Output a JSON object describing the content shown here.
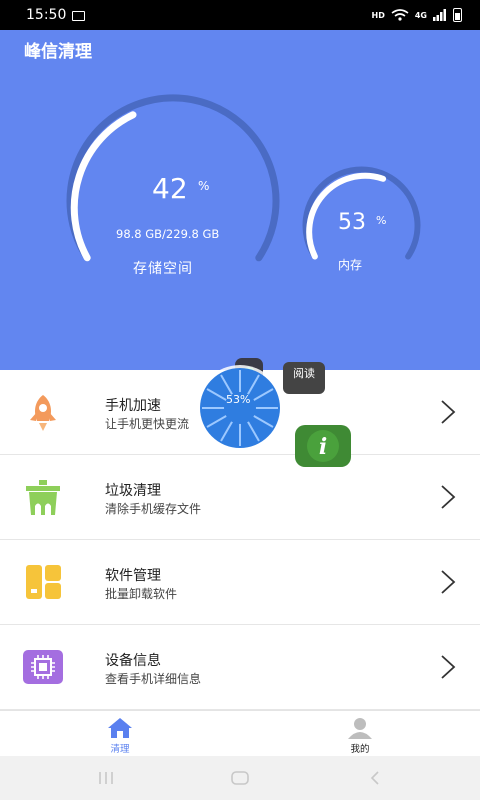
{
  "status_bar": {
    "time": "15:50",
    "hd": "HD",
    "network": "4G"
  },
  "app": {
    "title": "峰信清理"
  },
  "storage": {
    "percent": 42,
    "percent_value": "42",
    "percent_unit": "%",
    "size_text": "98.8 GB/229.8 GB",
    "label": "存储空间"
  },
  "memory": {
    "percent": 53,
    "percent_value": "53",
    "percent_unit": "%",
    "label": "内存"
  },
  "menu": [
    {
      "title": "手机加速",
      "subtitle": "让手机更快更流",
      "icon": "rocket-icon"
    },
    {
      "title": "垃圾清理",
      "subtitle": "清除手机缓存文件",
      "icon": "trash-bin-icon"
    },
    {
      "title": "软件管理",
      "subtitle": "批量卸载软件",
      "icon": "apps-grid-icon"
    },
    {
      "title": "设备信息",
      "subtitle": "查看手机详细信息",
      "icon": "chip-icon"
    }
  ],
  "float_ball": {
    "percent": "53%"
  },
  "float_app_read": "阅读",
  "bottom_nav": [
    {
      "label": "清理",
      "icon": "home-icon",
      "active": true
    },
    {
      "label": "我的",
      "icon": "user-icon",
      "active": false
    }
  ],
  "colors": {
    "header_bg": "#6286f0",
    "arc_track": "#4a6bc4",
    "accent": "#5a80ef"
  }
}
